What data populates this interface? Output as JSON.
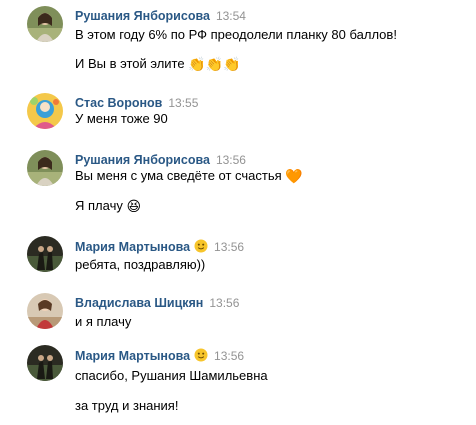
{
  "messages": [
    {
      "author": "Рушания Янборисова",
      "time": "13:54",
      "avatar": "woman-portrait-avatar",
      "lines": [
        {
          "text": "В этом году 6% по РФ преодолели планку 80 баллов!",
          "emoji": ""
        },
        {
          "text": "И Вы в этой элите",
          "emoji": "👏👏👏"
        }
      ]
    },
    {
      "author": "Стас Воронов",
      "time": "13:55",
      "avatar": "colorful-cartoon-avatar",
      "lines": [
        {
          "text": "У меня тоже 90",
          "emoji": ""
        }
      ]
    },
    {
      "author": "Рушания Янборисова",
      "time": "13:56",
      "avatar": "woman-portrait-avatar",
      "lines": [
        {
          "text": "Вы меня с ума сведёте от счастья",
          "emoji": "🧡"
        },
        {
          "text": "Я плачу",
          "emoji": "😆"
        }
      ]
    },
    {
      "author": "Мария Мартынова",
      "time": "13:56",
      "avatar": "dark-silhouette-avatar",
      "badge": "smiley-badge-icon",
      "lines": [
        {
          "text": "ребята, поздравляю))",
          "emoji": ""
        }
      ]
    },
    {
      "author": "Владислава Шицкян",
      "time": "13:56",
      "avatar": "girl-photo-avatar",
      "lines": [
        {
          "text": "и я плачу",
          "emoji": ""
        }
      ]
    },
    {
      "author": "Мария Мартынова",
      "time": "13:56",
      "avatar": "dark-silhouette-avatar",
      "badge": "smiley-badge-icon",
      "lines": [
        {
          "text": "спасибо, Рушания Шамильевна",
          "emoji": ""
        },
        {
          "text": "за труд и знания!",
          "emoji": ""
        }
      ]
    }
  ],
  "colors": {
    "author": "#2a5885",
    "time": "#939393",
    "text": "#000000"
  }
}
